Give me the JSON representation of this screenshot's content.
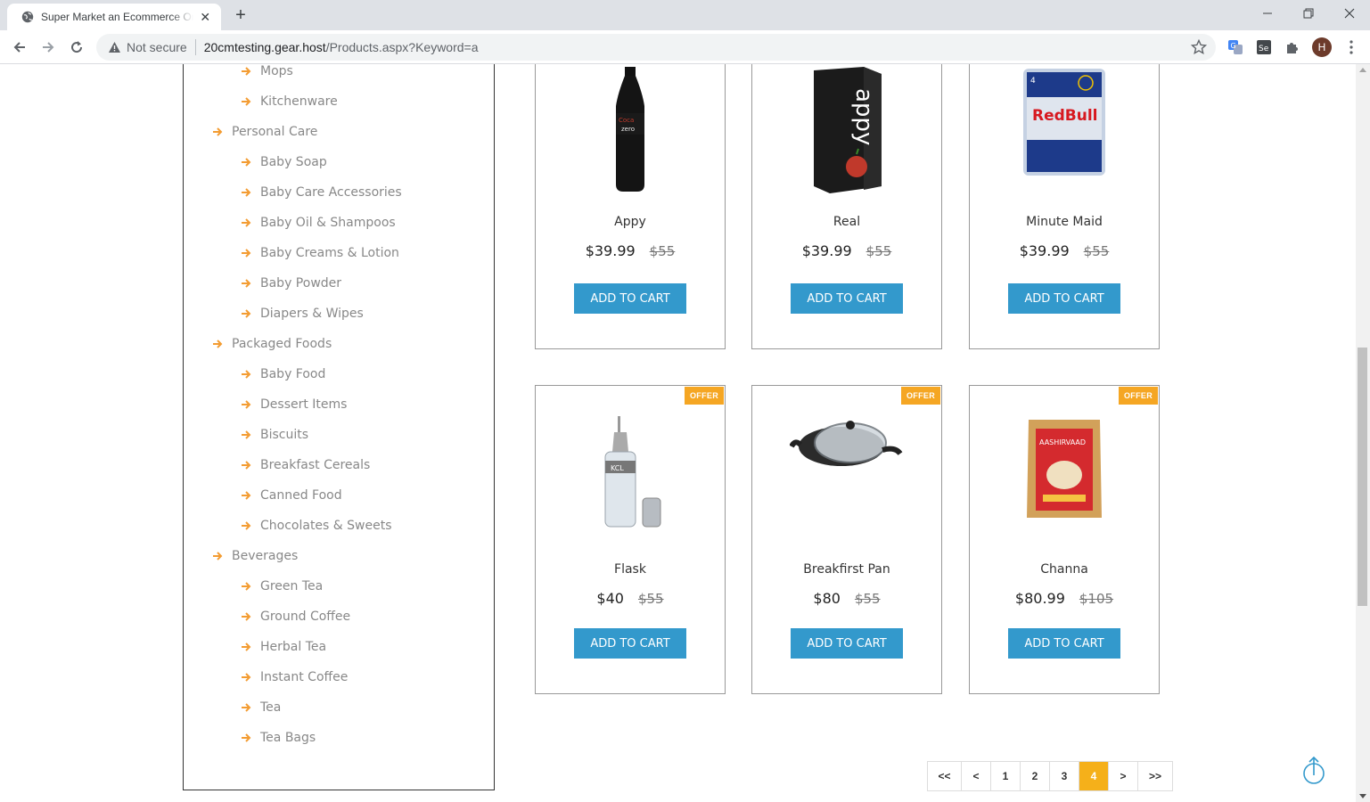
{
  "browser": {
    "tab_title": "Super Market an Ecommerce Online",
    "not_secure": "Not secure",
    "url_host": "20cmtesting.gear.host",
    "url_path": "/Products.aspx?Keyword=a",
    "avatar_letter": "H"
  },
  "sidebar": {
    "items": [
      {
        "label": "Mops",
        "level": 2
      },
      {
        "label": "Kitchenware",
        "level": 2
      },
      {
        "label": "Personal Care",
        "level": 1
      },
      {
        "label": "Baby Soap",
        "level": 2
      },
      {
        "label": "Baby Care Accessories",
        "level": 2
      },
      {
        "label": "Baby Oil & Shampoos",
        "level": 2
      },
      {
        "label": "Baby Creams & Lotion",
        "level": 2
      },
      {
        "label": "Baby Powder",
        "level": 2
      },
      {
        "label": "Diapers & Wipes",
        "level": 2
      },
      {
        "label": "Packaged Foods",
        "level": 1
      },
      {
        "label": "Baby Food",
        "level": 2
      },
      {
        "label": "Dessert Items",
        "level": 2
      },
      {
        "label": "Biscuits",
        "level": 2
      },
      {
        "label": "Breakfast Cereals",
        "level": 2
      },
      {
        "label": "Canned Food",
        "level": 2
      },
      {
        "label": "Chocolates & Sweets",
        "level": 2
      },
      {
        "label": "Beverages",
        "level": 1
      },
      {
        "label": "Green Tea",
        "level": 2
      },
      {
        "label": "Ground Coffee",
        "level": 2
      },
      {
        "label": "Herbal Tea",
        "level": 2
      },
      {
        "label": "Instant Coffee",
        "level": 2
      },
      {
        "label": "Tea",
        "level": 2
      },
      {
        "label": "Tea Bags",
        "level": 2
      }
    ]
  },
  "products": [
    {
      "name": "Appy",
      "price": "$39.99",
      "old_price": "$55",
      "button": "ADD TO CART",
      "offer": "",
      "image": "cola-bottle"
    },
    {
      "name": "Real",
      "price": "$39.99",
      "old_price": "$55",
      "button": "ADD TO CART",
      "offer": "",
      "image": "juice-carton"
    },
    {
      "name": "Minute Maid",
      "price": "$39.99",
      "old_price": "$55",
      "button": "ADD TO CART",
      "offer": "",
      "image": "energy-drink-pack"
    },
    {
      "name": "Flask",
      "price": "$40",
      "old_price": "$55",
      "button": "ADD TO CART",
      "offer": "OFFER",
      "image": "oil-dispenser"
    },
    {
      "name": "Breakfirst Pan",
      "price": "$80",
      "old_price": "$55",
      "button": "ADD TO CART",
      "offer": "OFFER",
      "image": "kadai-pan"
    },
    {
      "name": "Channa",
      "price": "$80.99",
      "old_price": "$105",
      "button": "ADD TO CART",
      "offer": "OFFER",
      "image": "flour-bag"
    }
  ],
  "pagination": {
    "pages": [
      "<<",
      "<",
      "1",
      "2",
      "3",
      "4",
      ">",
      ">>"
    ],
    "active": "4"
  },
  "colors": {
    "accent_orange": "#f5a623",
    "button_blue": "#3399cc",
    "arrow_orange": "#f39c32"
  }
}
